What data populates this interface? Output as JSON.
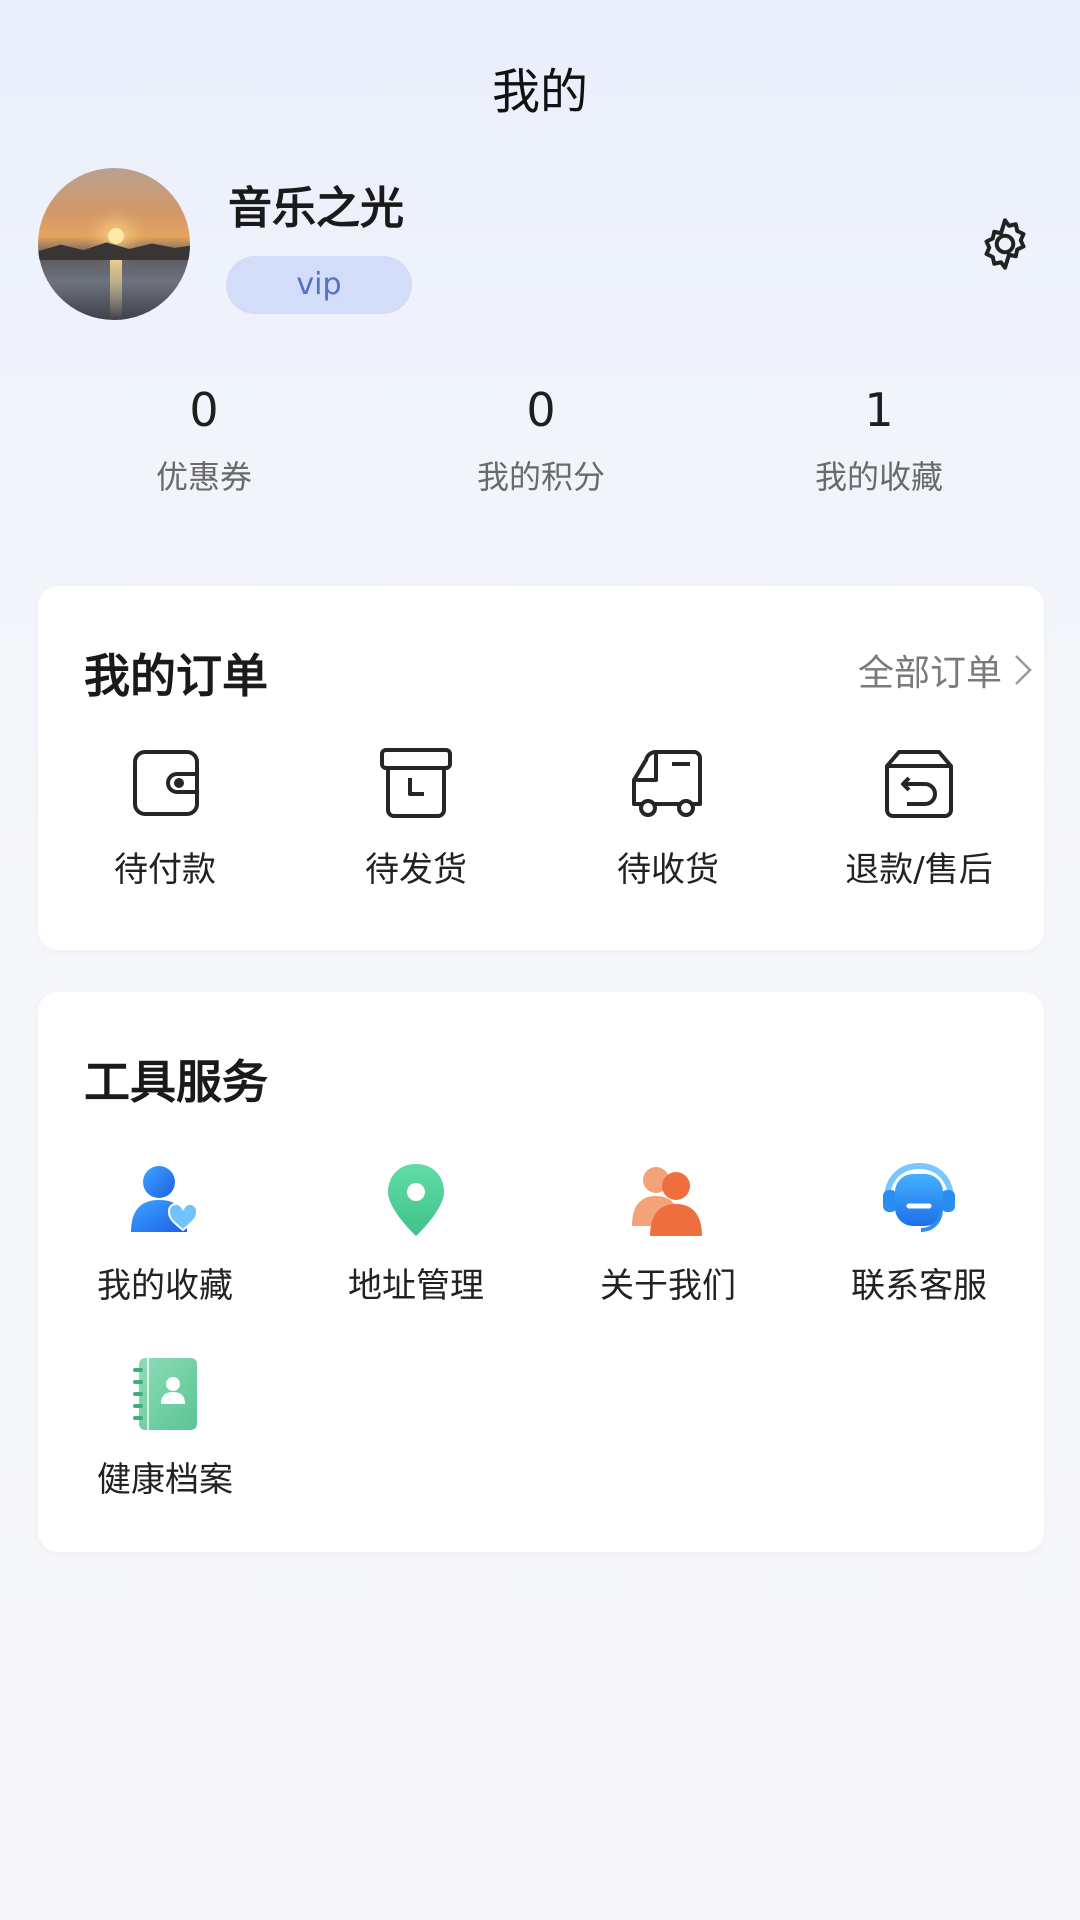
{
  "header": {
    "title": "我的"
  },
  "profile": {
    "username": "音乐之光",
    "badge": "vip",
    "settings_icon": "gear-icon"
  },
  "stats": [
    {
      "value": "0",
      "label": "优惠券"
    },
    {
      "value": "0",
      "label": "我的积分"
    },
    {
      "value": "1",
      "label": "我的收藏"
    }
  ],
  "orders": {
    "title": "我的订单",
    "all_link": "全部订单",
    "items": [
      {
        "label": "待付款",
        "icon": "wallet-icon"
      },
      {
        "label": "待发货",
        "icon": "box-clock-icon"
      },
      {
        "label": "待收货",
        "icon": "truck-icon"
      },
      {
        "label": "退款/售后",
        "icon": "return-box-icon"
      }
    ]
  },
  "tools": {
    "title": "工具服务",
    "items": [
      {
        "label": "我的收藏",
        "icon": "user-heart-icon"
      },
      {
        "label": "地址管理",
        "icon": "location-pin-icon"
      },
      {
        "label": "关于我们",
        "icon": "users-icon"
      },
      {
        "label": "联系客服",
        "icon": "headset-icon"
      },
      {
        "label": "健康档案",
        "icon": "contact-book-icon"
      }
    ]
  },
  "colors": {
    "accent": "#5470c8",
    "badge_bg": "#d3dcf8",
    "favorite_blue": "#2f7ef0",
    "address_green": "#4fcf9d",
    "about_orange": "#f07a4a",
    "service_blue": "#2c86f0",
    "health_green": "#6ccfa0"
  }
}
